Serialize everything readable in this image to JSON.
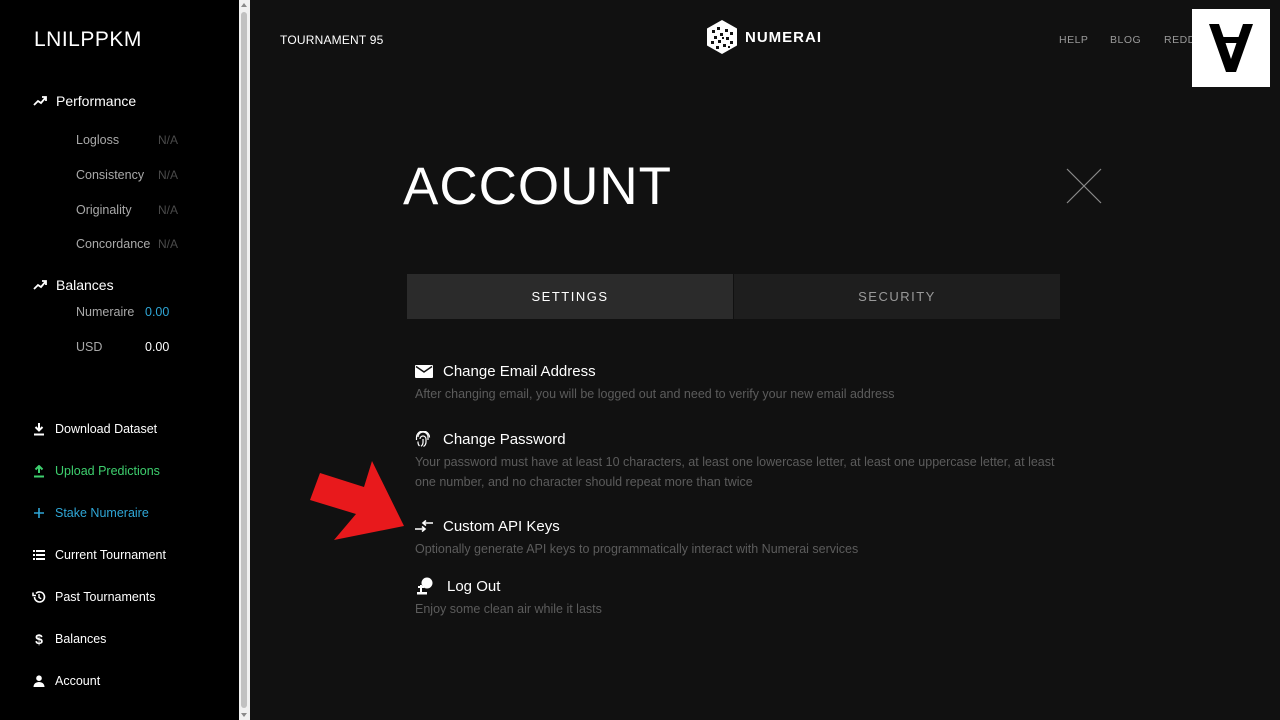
{
  "sidebar": {
    "username": "LNILPPKM",
    "performance": {
      "label": "Performance",
      "metrics": [
        {
          "label": "Logloss",
          "value": "N/A"
        },
        {
          "label": "Consistency",
          "value": "N/A"
        },
        {
          "label": "Originality",
          "value": "N/A"
        },
        {
          "label": "Concordance",
          "value": "N/A"
        }
      ]
    },
    "balances": {
      "label": "Balances",
      "items": [
        {
          "label": "Numeraire",
          "value": "0.00",
          "color": "#2fa6d6"
        },
        {
          "label": "USD",
          "value": "0.00",
          "color": "#ffffff"
        }
      ]
    },
    "nav": [
      {
        "label": "Download Dataset",
        "icon": "download-icon",
        "color": "#ffffff"
      },
      {
        "label": "Upload Predictions",
        "icon": "upload-icon",
        "color": "#3ecf6e"
      },
      {
        "label": "Stake Numeraire",
        "icon": "plus-icon",
        "color": "#2fa6d6"
      },
      {
        "label": "Current Tournament",
        "icon": "list-icon",
        "color": "#ffffff"
      },
      {
        "label": "Past Tournaments",
        "icon": "history-icon",
        "color": "#ffffff"
      },
      {
        "label": "Balances",
        "icon": "dollar-icon",
        "color": "#ffffff"
      },
      {
        "label": "Account",
        "icon": "person-icon",
        "color": "#ffffff"
      }
    ]
  },
  "header": {
    "tournament": "TOURNAMENT 95",
    "brand": "NUMERAI",
    "links": [
      "HELP",
      "BLOG",
      "REDD"
    ]
  },
  "main": {
    "title": "ACCOUNT",
    "tabs": [
      {
        "label": "SETTINGS",
        "active": true
      },
      {
        "label": "SECURITY",
        "active": false
      }
    ],
    "settings": [
      {
        "title": "Change Email Address",
        "icon": "envelope-icon",
        "description": "After changing email, you will be logged out and need to verify your new email address"
      },
      {
        "title": "Change Password",
        "icon": "fingerprint-icon",
        "description": "Your password must have at least 10 characters, at least one lowercase letter, at least one uppercase letter, at least one number, and no character should repeat more than twice"
      },
      {
        "title": "Custom API Keys",
        "icon": "swap-arrows-icon",
        "description": "Optionally generate API keys to programmatically interact with Numerai services"
      },
      {
        "title": "Log Out",
        "icon": "logout-icon",
        "description": "Enjoy some clean air while it lasts"
      }
    ]
  },
  "colors": {
    "accent_blue": "#2fa6d6",
    "accent_green": "#3ecf6e",
    "annotation_arrow": "#e8191c"
  }
}
